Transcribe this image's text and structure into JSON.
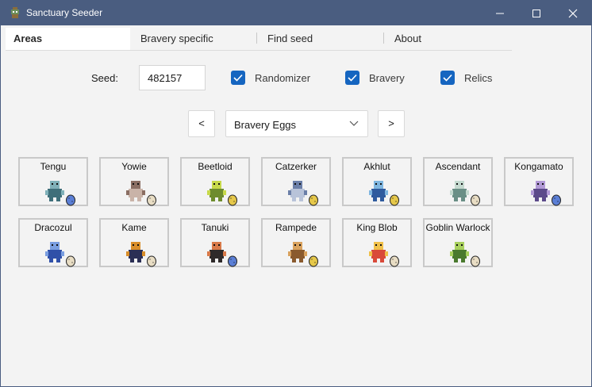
{
  "window": {
    "title": "Sanctuary Seeder",
    "app_icon": "sanctuary-seeder-app-icon"
  },
  "tabs": [
    {
      "label": "Areas",
      "active": true
    },
    {
      "label": "Bravery specific",
      "active": false
    },
    {
      "label": "Find seed",
      "active": false
    },
    {
      "label": "About",
      "active": false
    }
  ],
  "controls": {
    "seed_label": "Seed:",
    "seed_value": "482157",
    "checkboxes": [
      {
        "label": "Randomizer",
        "checked": true
      },
      {
        "label": "Bravery",
        "checked": true
      },
      {
        "label": "Relics",
        "checked": true
      }
    ],
    "prev_label": "<",
    "next_label": ">",
    "area_select": "Bravery Eggs"
  },
  "colors": {
    "titlebar": "#4a5d80",
    "accent": "#1565c0",
    "egg_blue": "#5b7fd6",
    "egg_beige": "#e8ddc4",
    "egg_gold": "#e6c84a"
  },
  "monsters": [
    {
      "name": "Tengu",
      "egg": "blue"
    },
    {
      "name": "Yowie",
      "egg": "beige"
    },
    {
      "name": "Beetloid",
      "egg": "gold"
    },
    {
      "name": "Catzerker",
      "egg": "gold"
    },
    {
      "name": "Akhlut",
      "egg": "gold"
    },
    {
      "name": "Ascendant",
      "egg": "beige"
    },
    {
      "name": "Kongamato",
      "egg": "blue"
    },
    {
      "name": "Dracozul",
      "egg": "beige"
    },
    {
      "name": "Kame",
      "egg": "beige"
    },
    {
      "name": "Tanuki",
      "egg": "blue"
    },
    {
      "name": "Rampede",
      "egg": "gold"
    },
    {
      "name": "King Blob",
      "egg": "beige"
    },
    {
      "name": "Goblin Warlock",
      "egg": "beige"
    }
  ]
}
